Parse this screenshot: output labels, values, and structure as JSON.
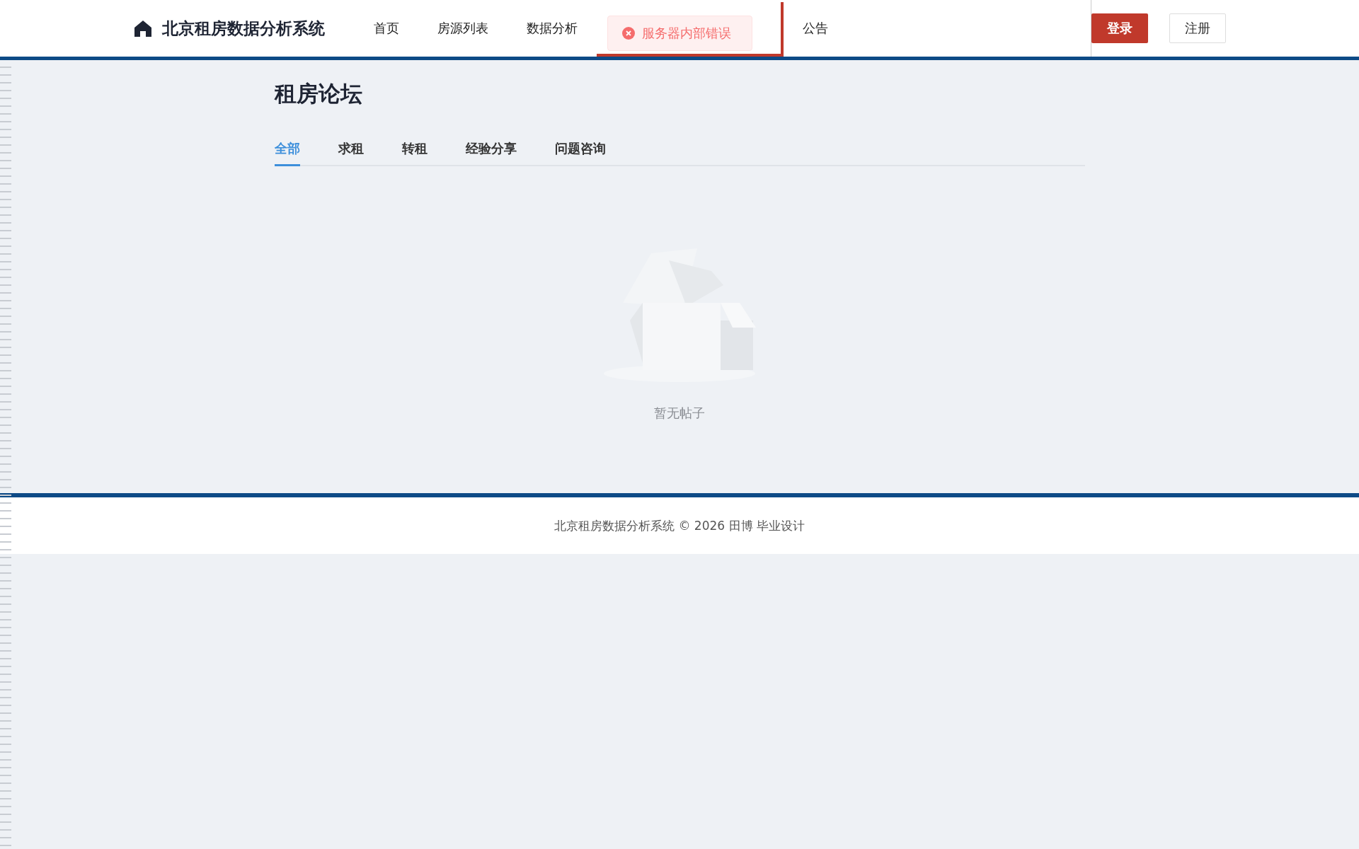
{
  "header": {
    "site_title": "北京租房数据分析系统",
    "nav": [
      {
        "label": "首页",
        "selected": false
      },
      {
        "label": "房源列表",
        "selected": false
      },
      {
        "label": "数据分析",
        "selected": false
      },
      {
        "selected": true
      },
      {
        "label": "公告",
        "selected": false
      }
    ],
    "auth_buttons": [
      {
        "label": "登录",
        "kind": "primary"
      },
      {
        "label": "注册",
        "kind": "secondary"
      }
    ]
  },
  "toast": {
    "kind": "error",
    "message": "服务器内部错误"
  },
  "page": {
    "title": "租房论坛",
    "tabs": [
      {
        "label": "全部",
        "selected": true
      },
      {
        "label": "求租",
        "selected": false
      },
      {
        "label": "转租",
        "selected": false
      },
      {
        "label": "经验分享",
        "selected": false
      },
      {
        "label": "问题咨询",
        "selected": false
      }
    ],
    "empty_text": "暂无帖子"
  },
  "footer": {
    "text": "北京租房数据分析系统 © 2026 田博 毕业设计"
  }
}
